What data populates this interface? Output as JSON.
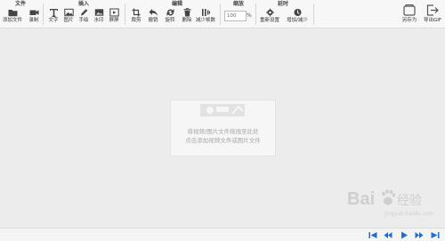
{
  "toolbar": {
    "groups": {
      "file": "文件",
      "insert": "插入",
      "edit": "编辑",
      "zoom": "缩放",
      "delay": "延时"
    },
    "file_tools": [
      "添加文件",
      "录制"
    ],
    "insert_tools": [
      "文字",
      "图片",
      "手绘",
      "水印",
      "屏屏"
    ],
    "edit_tools": [
      "裁剪",
      "撤销",
      "旋转",
      "删除",
      "减少帧数"
    ],
    "zoom_value": "100",
    "zoom_unit": "%",
    "delay_tools": [
      "重新设置",
      "增加/减少"
    ],
    "save_as": "另存为",
    "export_gif": "导出GIF"
  },
  "canvas": {
    "drop_line1": "将视频/图片文件拖拽至此处",
    "drop_line2": "点击添加视频文件或图片文件"
  },
  "watermark": {
    "brand": "Bai",
    "brand2": "经验",
    "sub": "jingyan.baidu.com"
  },
  "colors": {
    "accent": "#1e6fd0",
    "toolbar_bg": "#f7f7f7",
    "canvas_bg": "#ececec"
  }
}
